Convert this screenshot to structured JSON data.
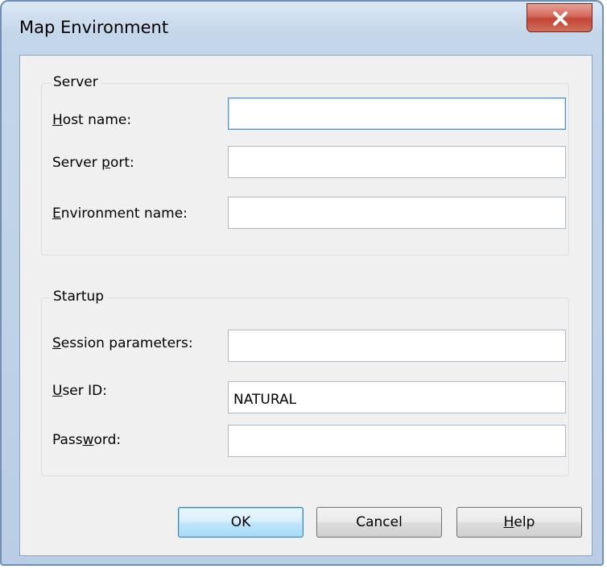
{
  "window": {
    "title": "Map Environment"
  },
  "server": {
    "legend": "Server",
    "host_label": {
      "key": "H",
      "rest": "ost name:"
    },
    "host_value": "",
    "port_label": {
      "pre": "Server ",
      "key": "p",
      "rest": "ort:"
    },
    "port_value": "",
    "env_label": {
      "key": "E",
      "rest": "nvironment name:"
    },
    "env_value": ""
  },
  "startup": {
    "legend": "Startup",
    "session_label": {
      "key": "S",
      "rest": "ession parameters:"
    },
    "session_value": "",
    "user_label": {
      "key": "U",
      "rest": "ser ID:"
    },
    "user_value": "NATURAL",
    "password_label": {
      "pre": "Pass",
      "key": "w",
      "rest": "ord:"
    },
    "password_value": ""
  },
  "buttons": {
    "ok": "OK",
    "cancel": "Cancel",
    "help": {
      "key": "H",
      "rest": "elp"
    }
  }
}
